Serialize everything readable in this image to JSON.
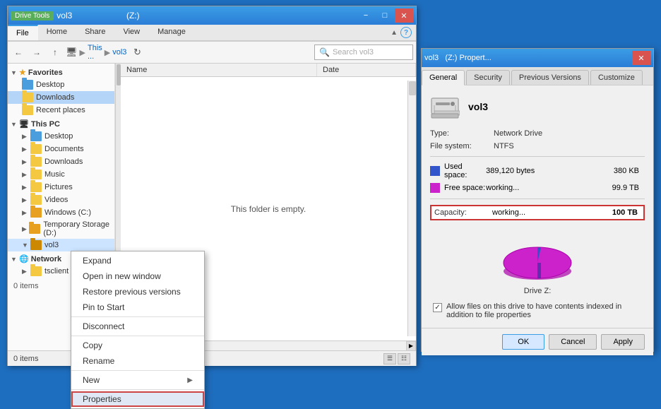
{
  "explorer": {
    "title": "vol3",
    "drive_label": "(Z:)",
    "title_full": "vol3",
    "drive_tools": "Drive Tools",
    "tabs": [
      "File",
      "Home",
      "Share",
      "View",
      "Manage"
    ],
    "active_tab": "File",
    "address": "This ... ▶ vol3",
    "search_placeholder": "Search vol3",
    "columns": [
      "Name",
      "Date"
    ],
    "empty_message": "This folder is empty.",
    "status": "0 items",
    "window_buttons": {
      "-": "minimize",
      "□": "maximize",
      "×": "close"
    }
  },
  "sidebar": {
    "favorites_label": "Favorites",
    "favorites_items": [
      {
        "label": "Desktop",
        "icon": "desktop-folder"
      },
      {
        "label": "Downloads",
        "icon": "folder"
      },
      {
        "label": "Recent places",
        "icon": "folder"
      }
    ],
    "thispc_label": "This PC",
    "thispc_items": [
      {
        "label": "Desktop",
        "icon": "desktop-folder"
      },
      {
        "label": "Documents",
        "icon": "folder"
      },
      {
        "label": "Downloads",
        "icon": "folder"
      },
      {
        "label": "Music",
        "icon": "folder"
      },
      {
        "label": "Pictures",
        "icon": "folder"
      },
      {
        "label": "Videos",
        "icon": "folder"
      },
      {
        "label": "Windows (C:)",
        "icon": "drive"
      },
      {
        "label": "Temporary Storage (D:)",
        "icon": "drive"
      }
    ],
    "vol3_label": "vol3",
    "network_label": "Network",
    "network_items": [
      {
        "label": "tsclient",
        "icon": "folder"
      }
    ],
    "network_sub_note": "0 items"
  },
  "context_menu": {
    "items": [
      {
        "label": "Expand",
        "sub": false
      },
      {
        "label": "Open in new window",
        "sub": false
      },
      {
        "label": "Restore previous versions",
        "sub": false
      },
      {
        "label": "Pin to Start",
        "sub": false
      },
      {
        "label": "Disconnect",
        "sub": false
      },
      {
        "label": "Copy",
        "sub": false
      },
      {
        "label": "Rename",
        "sub": false
      },
      {
        "label": "New",
        "sub": true
      },
      {
        "label": "Properties",
        "sub": false,
        "highlighted": true
      }
    ]
  },
  "props_dialog": {
    "title": "vol3",
    "subtitle": "(Z:) Propert...",
    "close_btn": "×",
    "tabs": [
      "General",
      "Security",
      "Previous Versions",
      "Customize"
    ],
    "active_tab": "General",
    "drive_name": "vol3",
    "type_label": "Type:",
    "type_value": "Network Drive",
    "fs_label": "File system:",
    "fs_value": "NTFS",
    "used_label": "Used space:",
    "used_bytes": "389,120 bytes",
    "used_size": "380 KB",
    "free_label": "Free space:",
    "free_bytes": "working...",
    "free_size": "99.9 TB",
    "capacity_label": "Capacity:",
    "capacity_bytes": "working...",
    "capacity_size": "100 TB",
    "pie_label": "Drive Z:",
    "checkbox_text": "Allow files on this drive to have contents indexed in addition to file properties",
    "btn_ok": "OK",
    "btn_cancel": "Cancel",
    "btn_apply": "Apply",
    "colors": {
      "used": "#3355cc",
      "free": "#cc22cc"
    }
  }
}
